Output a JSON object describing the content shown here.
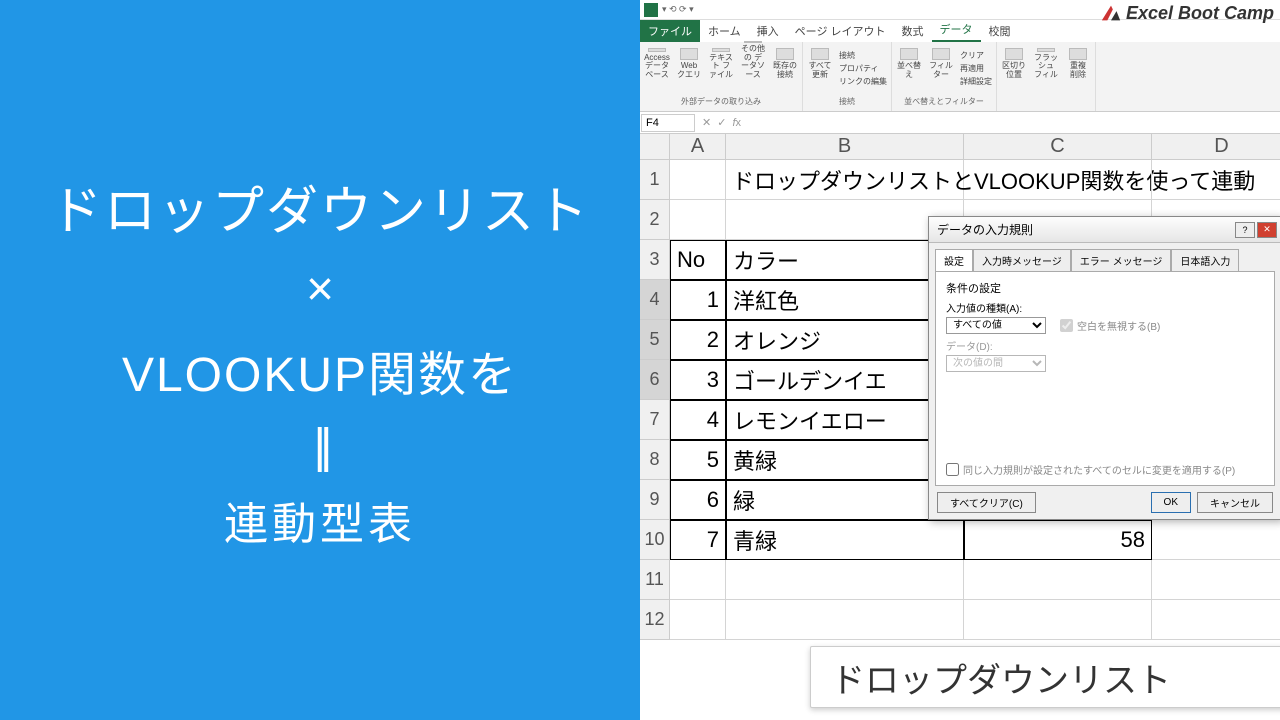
{
  "left": {
    "line1": "ドロップダウンリスト",
    "x": "×",
    "line2": "VLOOKUP関数を",
    "eq": "||",
    "line3": "連動型表"
  },
  "brand": "Excel Boot Camp",
  "tabs": {
    "file": "ファイル",
    "home": "ホーム",
    "insert": "挿入",
    "layout": "ページ レイアウト",
    "formula": "数式",
    "data": "データ",
    "review": "校閲"
  },
  "ribbon": {
    "ext": {
      "access": "Access\nデータベース",
      "web": "Web\nクエリ",
      "text": "テキスト\nファイル",
      "other": "その他の\nデータソース",
      "exist": "既存の\n接続",
      "label": "外部データの取り込み"
    },
    "conn": {
      "refresh": "すべて\n更新",
      "c1": "接続",
      "c2": "プロパティ",
      "c3": "リンクの編集",
      "label": "接続"
    },
    "sort": {
      "sort": "並べ替え",
      "filter": "フィルター",
      "f1": "クリア",
      "f2": "再適用",
      "f3": "詳細設定",
      "label": "並べ替えとフィルター"
    },
    "tools": {
      "t1": "区切り位置",
      "t2": "フラッシュ\nフィル",
      "t3": "重複\n削除"
    }
  },
  "namebox": "F4",
  "cols": [
    "A",
    "B",
    "C",
    "D"
  ],
  "rows": [
    "1",
    "2",
    "3",
    "4",
    "5",
    "6",
    "7",
    "8",
    "9",
    "10",
    "11",
    "12"
  ],
  "sheet": {
    "title": "ドロップダウンリストとVLOOKUP関数を使って連動",
    "hdrA": "No",
    "hdrB": "カラー",
    "r": [
      {
        "n": "1",
        "c": "洋紅色"
      },
      {
        "n": "2",
        "c": "オレンジ"
      },
      {
        "n": "3",
        "c": "ゴールデンイエ"
      },
      {
        "n": "4",
        "c": "レモンイエロー"
      },
      {
        "n": "5",
        "c": "黄緑"
      },
      {
        "n": "6",
        "c": "緑"
      },
      {
        "n": "7",
        "c": "青緑"
      }
    ],
    "c10": "58"
  },
  "dialog": {
    "title": "データの入力規則",
    "tabs": [
      "設定",
      "入力時メッセージ",
      "エラー メッセージ",
      "日本語入力"
    ],
    "section": "条件の設定",
    "l1": "入力値の種類(A):",
    "v1": "すべての値",
    "chk1": "空白を無視する(B)",
    "l2": "データ(D):",
    "v2": "次の値の間",
    "chk2": "同じ入力規則が設定されたすべてのセルに変更を適用する(P)",
    "clear": "すべてクリア(C)",
    "ok": "OK",
    "cancel": "キャンセル"
  },
  "balloon": "ドロップダウンリスト"
}
